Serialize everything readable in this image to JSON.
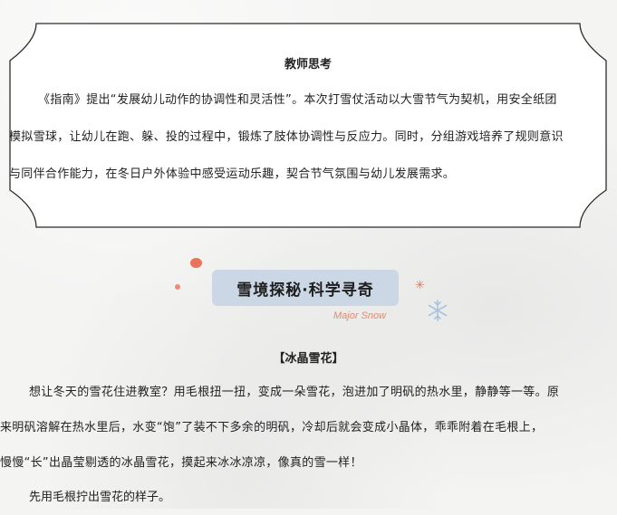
{
  "teacher_reflection": {
    "title": "教师思考",
    "lines": [
      "《指南》提出“发展幼儿动作的协调性和灵活性”。本次打雪仗活动以大雪节气为契机，用安全纸团",
      "模拟雪球，让幼儿在跑、躲、投的过程中，锻炼了肢体协调性与反应力。同时，分组游戏培养了规则意识",
      "与同伴合作能力，在冬日户外体验中感受运动乐趣，契合节气氛围与幼儿发展需求。"
    ]
  },
  "section": {
    "title": "雪境探秘·科学寻奇",
    "subtitle": "Major Snow"
  },
  "activity": {
    "heading": "【冰晶雪花】",
    "lines": [
      "想让冬天的雪花住进教室？用毛根扭一扭，变成一朵雪花，泡进加了明矾的热水里，静静等一等。原",
      "来明矾溶解在热水里后，水变“饱”了装不下多余的明矾，冷却后就会变成小晶体，乖乖附着在毛根上，",
      "慢慢“长”出晶莹剔透的冰晶雪花，摸起来冰冰凉凉，像真的雪一样！"
    ],
    "step1": "先用毛根拧出雪花的样子。"
  },
  "colors": {
    "accent_coral": "#e9725a",
    "banner_blue": "#cbd7e4",
    "snowflake_blue": "#a9c3dc"
  },
  "icons": [
    "snowflake-icon",
    "sparkle-icon"
  ]
}
